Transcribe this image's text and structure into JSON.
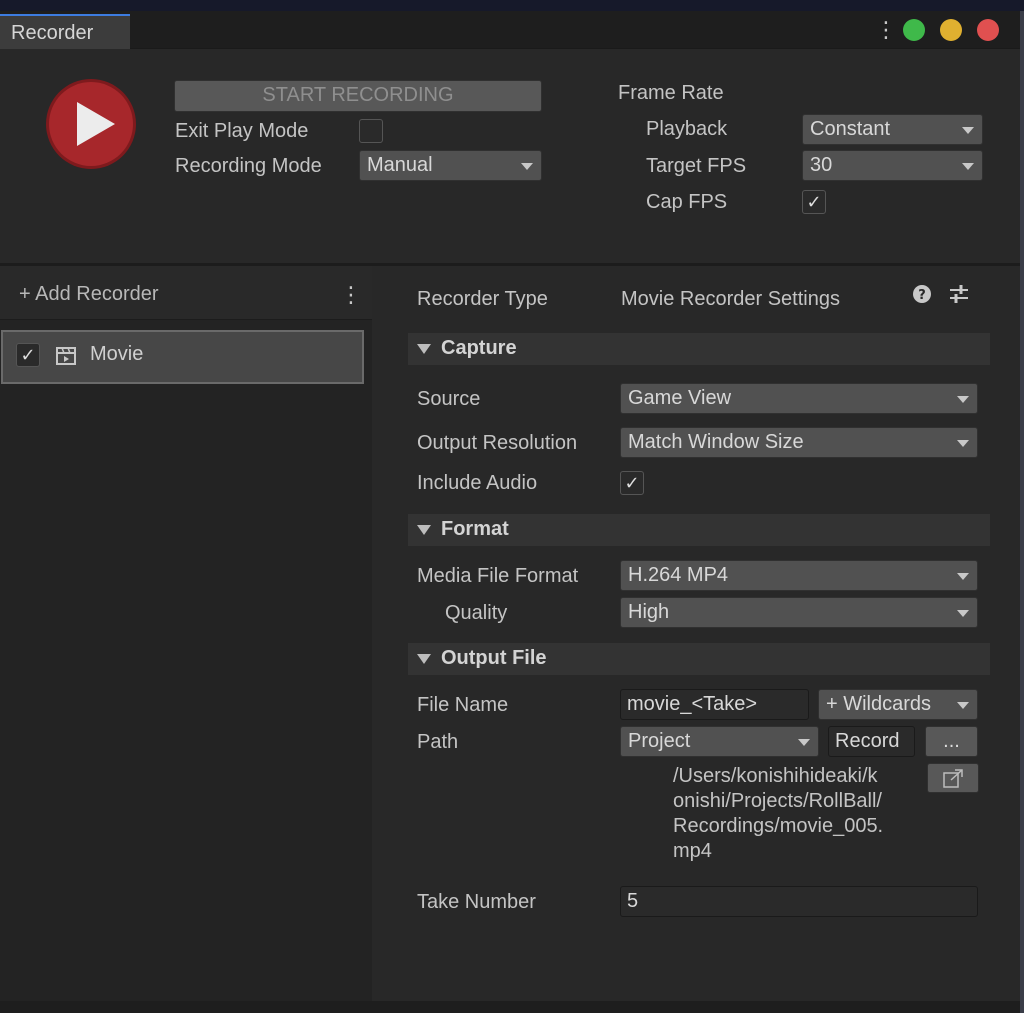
{
  "window": {
    "tab_title": "Recorder"
  },
  "colors": {
    "accent_tab": "#3d7ce0",
    "close": "#e05050",
    "minimize": "#e0b030",
    "maximize": "#3fb94a",
    "record_button": "#a7272b"
  },
  "header": {
    "start_button": "START RECORDING",
    "exit_play_mode_label": "Exit Play Mode",
    "exit_play_mode_checked": false,
    "recording_mode_label": "Recording Mode",
    "recording_mode_value": "Manual",
    "frame_rate_label": "Frame Rate",
    "playback_label": "Playback",
    "playback_value": "Constant",
    "target_fps_label": "Target FPS",
    "target_fps_value": "30",
    "cap_fps_label": "Cap FPS",
    "cap_fps_check": "✓"
  },
  "left_panel": {
    "add_recorder": "+ Add Recorder",
    "recorders": [
      {
        "label": "Movie",
        "check": "✓"
      }
    ]
  },
  "settings": {
    "recorder_type_label": "Recorder Type",
    "recorder_type_value": "Movie Recorder Settings",
    "capture": {
      "title": "Capture",
      "source_label": "Source",
      "source_value": "Game View",
      "resolution_label": "Output Resolution",
      "resolution_value": "Match Window Size",
      "audio_label": "Include Audio",
      "audio_check": "✓"
    },
    "format": {
      "title": "Format",
      "media_label": "Media File Format",
      "media_value": "H.264 MP4",
      "quality_label": "Quality",
      "quality_value": "High"
    },
    "output": {
      "title": "Output File",
      "file_name_label": "File Name",
      "file_name_value": "movie_<Take>",
      "wildcards": "+ Wildcards",
      "path_label": "Path",
      "path_value": "Project",
      "path_field": "Record",
      "browse": "...",
      "full_path_lines": [
        "/Users/konishihideaki/k",
        "onishi/Projects/RollBall/",
        "Recordings/movie_005.",
        "mp4"
      ],
      "take_label": "Take Number",
      "take_value": "5"
    }
  }
}
